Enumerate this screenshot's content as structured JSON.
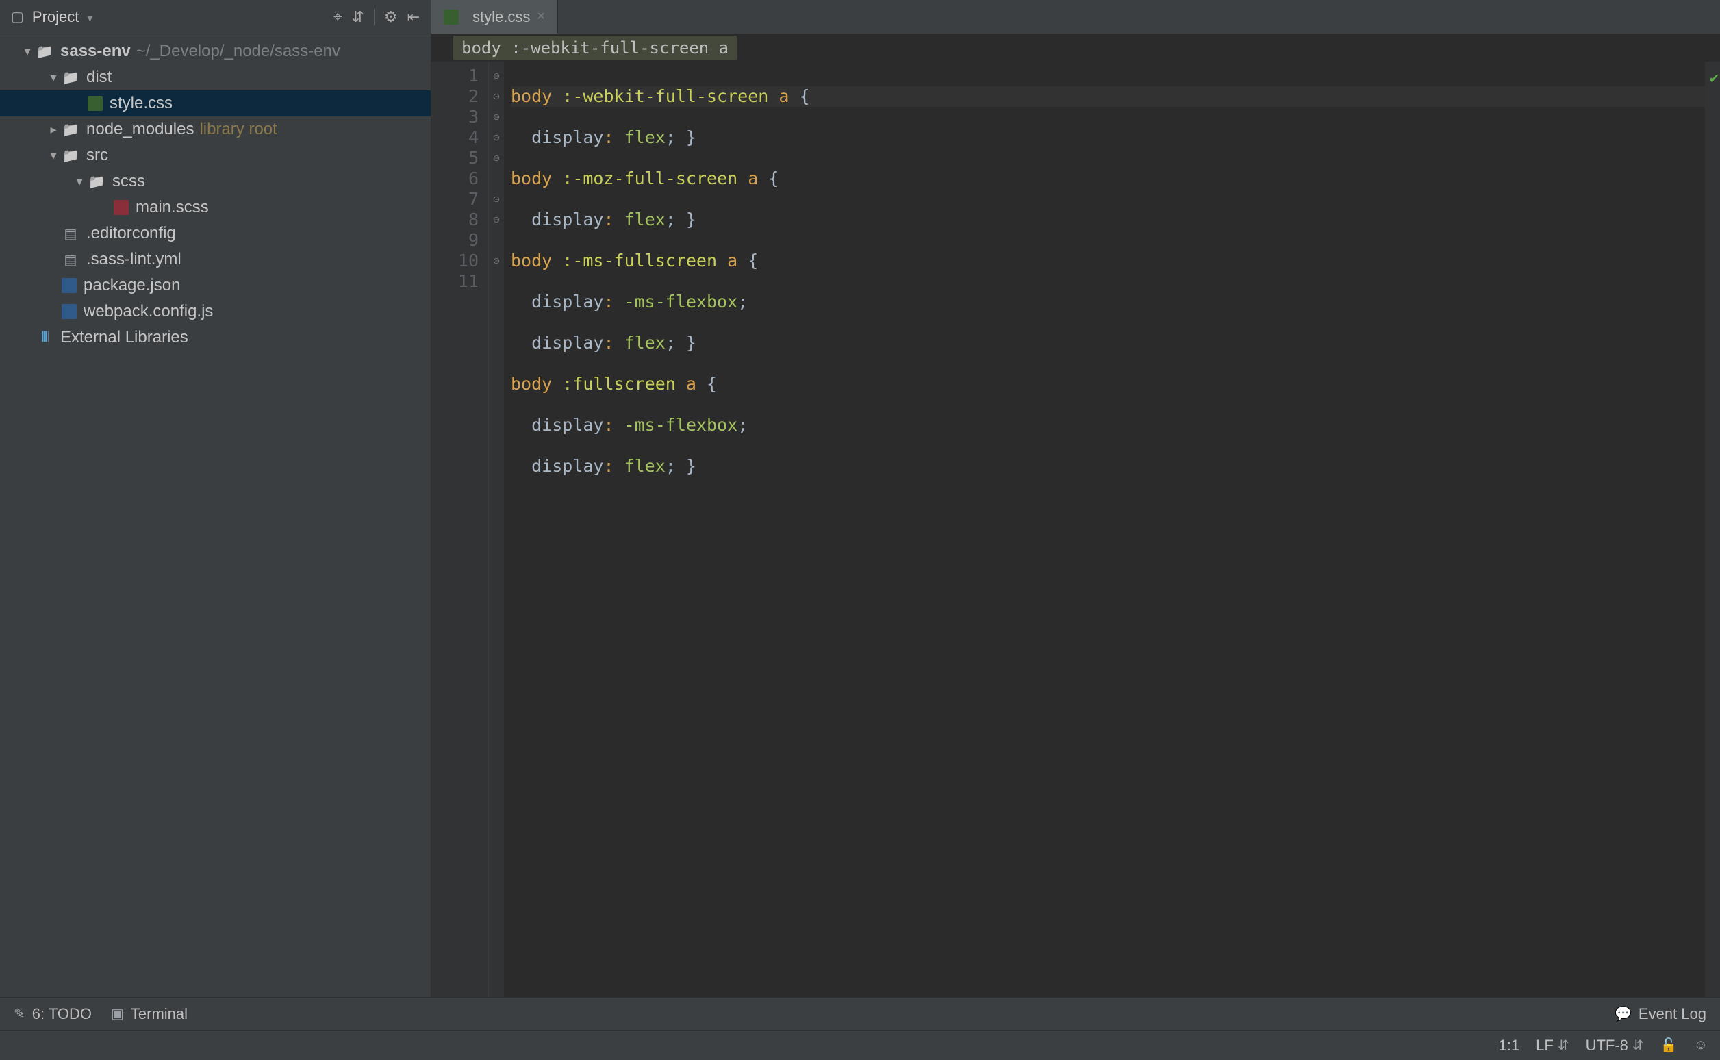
{
  "projectPanel": {
    "title": "Project",
    "icons": {
      "target": "⌖",
      "collapse": "⇵",
      "settings": "⚙",
      "hide": "⇤"
    }
  },
  "tree": {
    "root": {
      "name": "sass-env",
      "path": "~/_Develop/_node/sass-env"
    },
    "dist": "dist",
    "style_css": "style.css",
    "node_modules": "node_modules",
    "node_modules_annot": "library root",
    "src": "src",
    "scss": "scss",
    "main_scss": "main.scss",
    "editorconfig": ".editorconfig",
    "sass_lint": ".sass-lint.yml",
    "package_json": "package.json",
    "webpack_config": "webpack.config.js",
    "external_libs": "External Libraries"
  },
  "tabs": {
    "style_css": "style.css"
  },
  "breadcrumb": "body :-webkit-full-screen a",
  "code": {
    "l1": {
      "sel": "body",
      "rest": " :-webkit-full-screen ",
      "child": "a",
      "tail": " {"
    },
    "l2": {
      "prop": "display",
      "colon": ": ",
      "val": "flex",
      "tail": "; }"
    },
    "l3": {
      "sel": "body",
      "rest": " :-moz-full-screen ",
      "child": "a",
      "tail": " {"
    },
    "l4": {
      "prop": "display",
      "colon": ": ",
      "val": "flex",
      "tail": "; }"
    },
    "l5": {
      "sel": "body",
      "rest": " :-ms-fullscreen ",
      "child": "a",
      "tail": " {"
    },
    "l6": {
      "prop": "display",
      "colon": ": ",
      "val": "-ms-flexbox",
      "tail": ";"
    },
    "l7": {
      "prop": "display",
      "colon": ": ",
      "val": "flex",
      "tail": "; }"
    },
    "l8": {
      "sel": "body",
      "rest": " :fullscreen ",
      "child": "a",
      "tail": " {"
    },
    "l9": {
      "prop": "display",
      "colon": ": ",
      "val": "-ms-flexbox",
      "tail": ";"
    },
    "l10": {
      "prop": "display",
      "colon": ": ",
      "val": "flex",
      "tail": "; }"
    }
  },
  "lineNumbers": [
    "1",
    "2",
    "3",
    "4",
    "5",
    "6",
    "7",
    "8",
    "9",
    "10",
    "11"
  ],
  "bottomToolbar": {
    "todo_label": "6: TODO",
    "terminal_label": "Terminal",
    "event_log": "Event Log"
  },
  "statusBar": {
    "position": "1:1",
    "line_sep": "LF",
    "encoding": "UTF-8"
  }
}
